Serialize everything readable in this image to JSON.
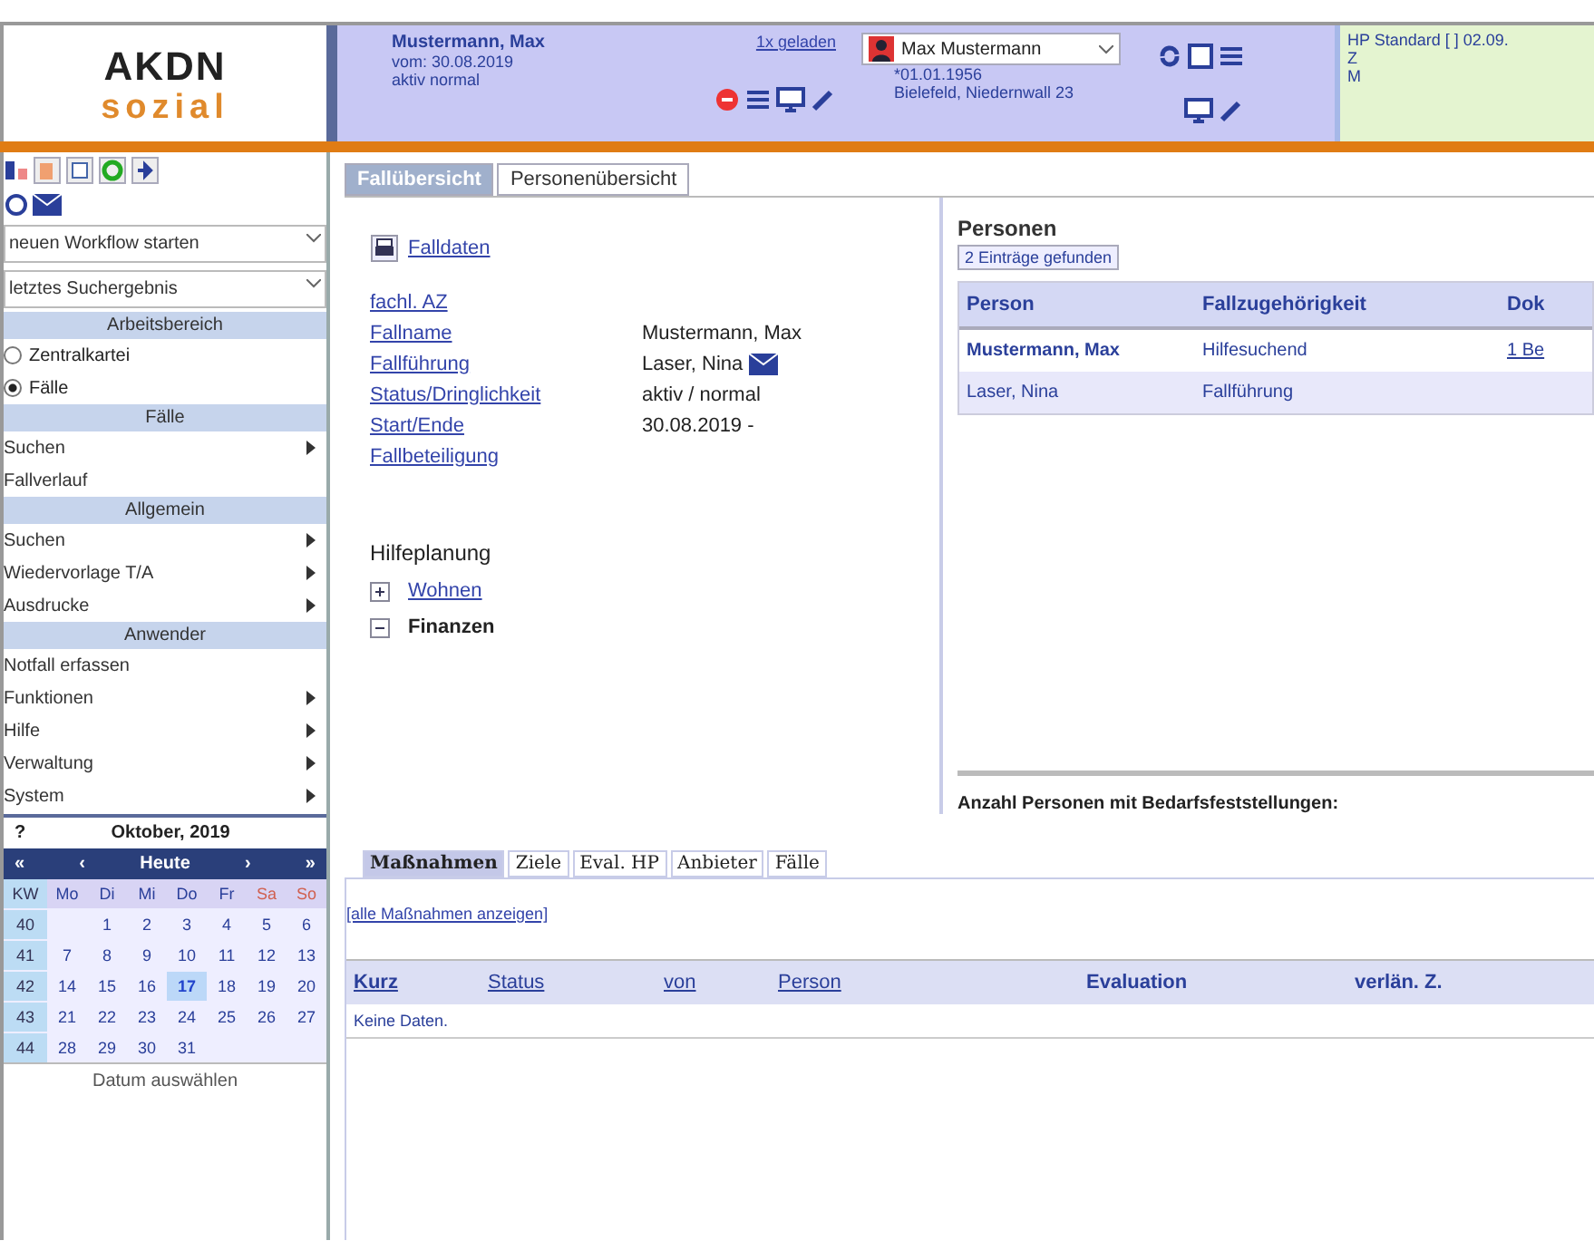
{
  "logo": {
    "title": "AKDN",
    "subtitle": "sozial"
  },
  "case_header": {
    "name": "Mustermann, Max",
    "since": "vom: 30.08.2019",
    "status": "aktiv normal",
    "loaded_link": "1x geladen"
  },
  "person_header": {
    "person": "Max Mustermann",
    "birth": "*01.01.1956",
    "address": "Bielefeld, Niedernwall 23"
  },
  "plan_panel": {
    "lines": [
      "HP Standard [ ] 02.09.",
      "Z",
      "M"
    ]
  },
  "sidebar": {
    "selects": [
      "neuen Workflow starten",
      "letztes Suchergebnis"
    ],
    "sections": [
      {
        "title": "Arbeitsbereich",
        "items": [
          {
            "kind": "radio",
            "label": "Zentralkartei",
            "selected": false
          },
          {
            "kind": "radio",
            "label": "Fälle",
            "selected": true
          }
        ]
      },
      {
        "title": "Fälle",
        "items": [
          {
            "kind": "menu",
            "label": "Suchen",
            "submenu": true
          },
          {
            "kind": "menu",
            "label": "Fallverlauf",
            "submenu": false
          }
        ]
      },
      {
        "title": "Allgemein",
        "items": [
          {
            "kind": "menu",
            "label": "Suchen",
            "submenu": true
          },
          {
            "kind": "menu",
            "label": "Wiedervorlage T/A",
            "submenu": true
          },
          {
            "kind": "menu",
            "label": "Ausdrucke",
            "submenu": true
          }
        ]
      },
      {
        "title": "Anwender",
        "items": [
          {
            "kind": "menu",
            "label": "Notfall erfassen",
            "submenu": false
          },
          {
            "kind": "menu",
            "label": "Funktionen",
            "submenu": true
          },
          {
            "kind": "menu",
            "label": "Hilfe",
            "submenu": true
          },
          {
            "kind": "menu",
            "label": "Verwaltung",
            "submenu": true
          },
          {
            "kind": "menu",
            "label": "System",
            "submenu": true
          }
        ]
      }
    ]
  },
  "calendar": {
    "help": "?",
    "month": "Oktober, 2019",
    "nav": [
      "«",
      "‹",
      "Heute",
      "›",
      "»"
    ],
    "week_label": "KW",
    "weekdays": [
      "Mo",
      "Di",
      "Mi",
      "Do",
      "Fr",
      "Sa",
      "So"
    ],
    "weeks": [
      {
        "kw": "40",
        "days": [
          {
            "n": "1",
            "selected": false
          },
          {
            "n": "2",
            "selected": false
          },
          {
            "n": "3",
            "selected": false
          },
          {
            "n": "4",
            "selected": false
          },
          {
            "n": "5",
            "selected": false
          },
          {
            "n": "6",
            "selected": false
          }
        ]
      },
      {
        "kw": "41",
        "days": [
          {
            "n": "7",
            "selected": false
          },
          {
            "n": "8",
            "selected": false
          },
          {
            "n": "9",
            "selected": false
          },
          {
            "n": "10",
            "selected": false
          },
          {
            "n": "11",
            "selected": false
          },
          {
            "n": "12",
            "selected": false
          },
          {
            "n": "13",
            "selected": false
          }
        ]
      },
      {
        "kw": "42",
        "days": [
          {
            "n": "14",
            "selected": false
          },
          {
            "n": "15",
            "selected": false
          },
          {
            "n": "16",
            "selected": false
          },
          {
            "n": "17",
            "selected": true
          },
          {
            "n": "18",
            "selected": false
          },
          {
            "n": "19",
            "selected": false
          },
          {
            "n": "20",
            "selected": false
          }
        ]
      },
      {
        "kw": "43",
        "days": [
          {
            "n": "21",
            "selected": false
          },
          {
            "n": "22",
            "selected": false
          },
          {
            "n": "23",
            "selected": false
          },
          {
            "n": "24",
            "selected": false
          },
          {
            "n": "25",
            "selected": false
          },
          {
            "n": "26",
            "selected": false
          },
          {
            "n": "27",
            "selected": false
          }
        ]
      },
      {
        "kw": "44",
        "days": [
          {
            "n": "28",
            "selected": false
          },
          {
            "n": "29",
            "selected": false
          },
          {
            "n": "30",
            "selected": false
          },
          {
            "n": "31",
            "selected": false
          }
        ]
      }
    ],
    "footer": "Datum auswählen"
  },
  "tabs": [
    {
      "label": "Fallübersicht",
      "selected": true
    },
    {
      "label": "Personenübersicht",
      "selected": false
    }
  ],
  "case_data": {
    "link": "Falldaten",
    "fields": [
      {
        "label": "fachl. AZ"
      },
      {
        "label": "Fallname",
        "value": "Mustermann, Max"
      },
      {
        "label": "Fallführung",
        "value": "Laser, Nina",
        "mail": true
      },
      {
        "label": "Status/Dringlichkeit",
        "value": "aktiv / normal"
      },
      {
        "label": "Start/Ende",
        "value": "30.08.2019 -"
      },
      {
        "label": "Fallbeteiligung"
      }
    ]
  },
  "help_planning": {
    "title": "Hilfeplanung",
    "items": [
      {
        "label": "Wohnen",
        "expanded": false,
        "link": true
      },
      {
        "label": "Finanzen",
        "expanded": true,
        "link": false
      }
    ]
  },
  "persons": {
    "title": "Personen",
    "count": "2 Einträge gefunden",
    "columns": [
      "Person",
      "Fallzugehörigkeit",
      "Dok"
    ],
    "rows": [
      {
        "cells": [
          "Mustermann, Max",
          "Hilfesuchend",
          "1 Be"
        ],
        "bold": true
      },
      {
        "cells": [
          "Laser, Nina",
          "Fallführung"
        ],
        "bold": false
      }
    ],
    "footer": "Anzahl Personen mit Bedarfsfeststellungen:"
  },
  "measures": {
    "tabs": [
      {
        "label": "Maßnahmen",
        "selected": true
      },
      {
        "label": "Ziele",
        "selected": false
      },
      {
        "label": "Eval. HP",
        "selected": false
      },
      {
        "label": "Anbieter",
        "selected": false
      },
      {
        "label": "Fälle",
        "selected": false
      }
    ],
    "link": "[alle Maßnahmen anzeigen]",
    "columns": [
      "Kurz",
      "Status",
      "von",
      "Person",
      "Evaluation",
      "verlän. Z."
    ],
    "empty": "Keine Daten."
  }
}
